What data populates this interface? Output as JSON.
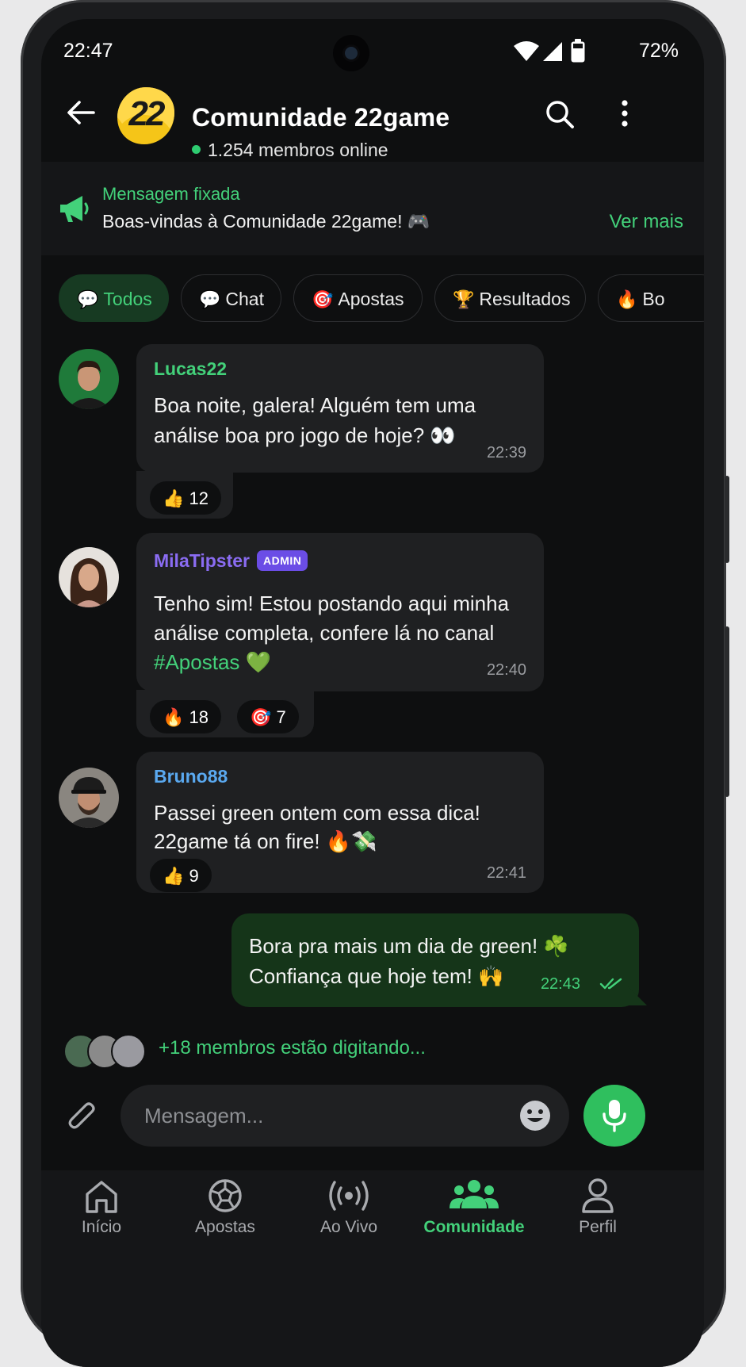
{
  "status_bar": {
    "time": "22:47",
    "battery": "72%"
  },
  "header": {
    "logo_text": "22",
    "title": "Comunidade 22game",
    "online": "1.254 membros online"
  },
  "pinned": {
    "label": "Mensagem fixada",
    "text": "Boas-vindas à Comunidade 22game! 🎮",
    "more": "Ver mais"
  },
  "chips": [
    {
      "icon": "💬",
      "label": "Todos"
    },
    {
      "icon": "💬",
      "label": "Chat"
    },
    {
      "icon": "🎯",
      "label": "Apostas"
    },
    {
      "icon": "🏆",
      "label": "Resultados"
    },
    {
      "icon": "🔥",
      "label": "Bo"
    }
  ],
  "messages": [
    {
      "user": "Lucas22",
      "user_color": "#43d17a",
      "lines": [
        "Boa noite, galera! Alguém tem uma",
        "análise boa pro jogo de hoje? 👀"
      ],
      "time": "22:39",
      "reactions": [
        {
          "emoji": "👍",
          "count": "12"
        }
      ]
    },
    {
      "user": "MilaTipster",
      "user_color": "#8a6cf2",
      "badge": "ADMIN",
      "lines": [
        "Tenho sim! Estou postando aqui minha",
        "análise completa, confere lá no canal"
      ],
      "hashtag": "#Apostas",
      "hashtag_suffix": " 💚",
      "time": "22:40",
      "reactions": [
        {
          "emoji": "🔥",
          "count": "18"
        },
        {
          "emoji": "🎯",
          "count": "7"
        }
      ]
    },
    {
      "user": "Bruno88",
      "user_color": "#5aa9f0",
      "lines": [
        "Passei green ontem com essa dica!",
        "22game tá on fire! 🔥💸"
      ],
      "time": "22:41",
      "reactions": [
        {
          "emoji": "👍",
          "count": "9"
        }
      ]
    }
  ],
  "outgoing": {
    "lines": [
      "Bora pra mais um dia de green! ☘️",
      "Confiança que hoje tem! 🙌"
    ],
    "time": "22:43",
    "read_icon": "double-check-icon"
  },
  "typing": "+18 membros estão digitando...",
  "composer": {
    "placeholder": "Mensagem..."
  },
  "nav": [
    {
      "label": "Início",
      "icon": "home-icon"
    },
    {
      "label": "Apostas",
      "icon": "soccer-ball-icon"
    },
    {
      "label": "Ao Vivo",
      "icon": "broadcast-icon"
    },
    {
      "label": "Comunidade",
      "icon": "community-icon",
      "active": true
    },
    {
      "label": "Perfil",
      "icon": "profile-icon"
    }
  ],
  "colors": {
    "accent": "#43d17a",
    "background": "#0e0f10",
    "bubble": "#1f2022",
    "outgoing_bubble": "#153519",
    "admin_badge": "#6b4de6"
  }
}
